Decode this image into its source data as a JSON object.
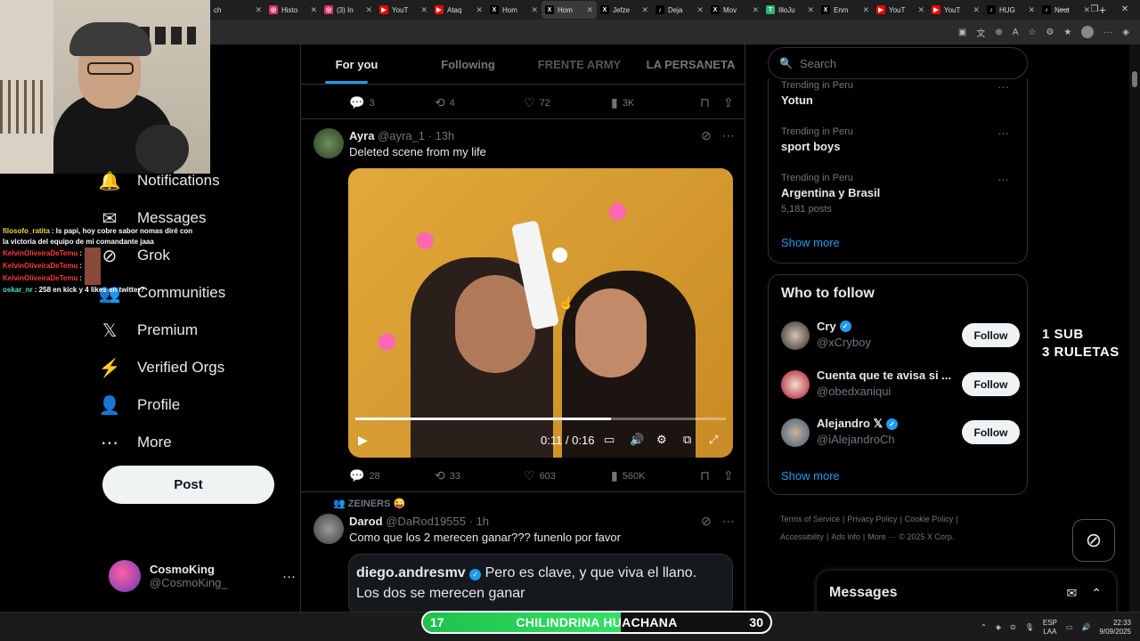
{
  "browser": {
    "tabs": [
      {
        "title": "Histo",
        "fav_color": "#e1306c",
        "fav": "◎"
      },
      {
        "title": "(3) In",
        "fav_color": "#e1306c",
        "fav": "◎"
      },
      {
        "title": "YouT",
        "fav_color": "#ff0000",
        "fav": "▶"
      },
      {
        "title": "Ataq",
        "fav_color": "#ff0000",
        "fav": "▶"
      },
      {
        "title": "Hom",
        "fav_color": "#000000",
        "fav": "X"
      },
      {
        "title": "Hom",
        "fav_color": "#000000",
        "fav": "X"
      },
      {
        "title": "Jefze",
        "fav_color": "#000000",
        "fav": "X"
      },
      {
        "title": "Deja",
        "fav_color": "#000000",
        "fav": "♪"
      },
      {
        "title": "Mov",
        "fav_color": "#000000",
        "fav": "X"
      },
      {
        "title": "IlloJu",
        "fav_color": "#2bb673",
        "fav": "T"
      },
      {
        "title": "Enm",
        "fav_color": "#000000",
        "fav": "X"
      },
      {
        "title": "YouT",
        "fav_color": "#ff0000",
        "fav": "▶"
      },
      {
        "title": "YouT",
        "fav_color": "#ff0000",
        "fav": "▶"
      },
      {
        "title": "HUG",
        "fav_color": "#000000",
        "fav": "♪"
      },
      {
        "title": "Neut",
        "fav_color": "#000000",
        "fav": "♪"
      }
    ],
    "active_tab_index": 5,
    "first_partial_tab": "ch"
  },
  "chat": [
    {
      "user": "filosofo_ratita",
      "user_color": "#f5d442",
      "text": " : Is papi, hoy cobre sabor nomas diré con"
    },
    {
      "user": "",
      "user_color": "#ffffff",
      "text": "la victoria del equipo de mi comandante jaaa"
    },
    {
      "user": "KelvinOliveiraDeTemu",
      "user_color": "#ff3b3b",
      "text": " :",
      "thumb": true
    },
    {
      "user": "KelvinOliveiraDeTemu",
      "user_color": "#ff3b3b",
      "text": " :",
      "thumb": true
    },
    {
      "user": "KelvinOliveiraDeTemu",
      "user_color": "#ff3b3b",
      "text": " :",
      "thumb": true
    },
    {
      "user": "oskar_nr",
      "user_color": "#4de3c9",
      "text": " : 258 en kick y 4 likes en twitter?"
    }
  ],
  "nav": [
    {
      "label": "Notifications",
      "icon": "🔔",
      "name": "bell-icon"
    },
    {
      "label": "Messages",
      "icon": "✉",
      "name": "envelope-icon"
    },
    {
      "label": "Grok",
      "icon": "⊘",
      "name": "grok-icon"
    },
    {
      "label": "Communities",
      "icon": "👥",
      "name": "communities-icon"
    },
    {
      "label": "Premium",
      "icon": "𝕏",
      "name": "x-logo-icon"
    },
    {
      "label": "Verified Orgs",
      "icon": "⚡",
      "name": "lightning-icon"
    },
    {
      "label": "Profile",
      "icon": "👤",
      "name": "person-icon"
    },
    {
      "label": "More",
      "icon": "⋯",
      "name": "more-circle-icon"
    }
  ],
  "post_button": "Post",
  "account": {
    "name": "CosmoKing",
    "handle": "@CosmoKing_",
    "dots": "···"
  },
  "feed_tabs": [
    "For you",
    "Following",
    "FRENTE ARMY",
    "LA PERSANETA"
  ],
  "tweet_prev_actions": {
    "replies": "3",
    "reposts": "4",
    "likes": "72",
    "views": "3K"
  },
  "tweet1": {
    "name": "Ayra",
    "handle": "@ayra_1",
    "time": "· 13h",
    "text": "Deleted scene from my life",
    "video_time": "0:11 / 0:16",
    "video_progress": 0.69,
    "actions": {
      "replies": "28",
      "reposts": "33",
      "likes": "603",
      "views": "560K"
    }
  },
  "tweet2": {
    "social_context": "ZEINERS 😜",
    "name": "Darod",
    "handle": "@DaRod19555",
    "time": "· 1h",
    "text": "Como que los 2 merecen ganar??? funenlo por favor",
    "quote_name": "diego.andresmv",
    "quote_text1": "Pero es clave, y que viva el llano.",
    "quote_text2": "Los dos se merecen ganar"
  },
  "search": {
    "placeholder": "Search"
  },
  "trends": [
    {
      "context": "Trending in Peru",
      "title": "Yotun",
      "count": ""
    },
    {
      "context": "Trending in Peru",
      "title": "sport boys",
      "count": ""
    },
    {
      "context": "Trending in Peru",
      "title": "Argentina y Brasil",
      "count": "5,181 posts"
    }
  ],
  "show_more": "Show more",
  "who_to_follow": {
    "title": "Who to follow",
    "follow_label": "Follow",
    "accounts": [
      {
        "name": "Cry",
        "handle": "@xCryboy",
        "verified": true
      },
      {
        "name": "Cuenta que te avisa si ...",
        "handle": "@obedxaniqui",
        "verified": false
      },
      {
        "name": "Alejandro 𝕏",
        "handle": "@iAlejandroCh",
        "verified": true
      }
    ]
  },
  "footer": {
    "l1": [
      "Terms of Service",
      "|",
      "Privacy Policy",
      "|",
      "Cookie Policy",
      "|"
    ],
    "l2": [
      "Accessibility",
      "|",
      "Ads info",
      "|",
      "More ···",
      "© 2025 X Corp."
    ]
  },
  "overlay": {
    "line1": "1 SUB",
    "line2": "3 RULETAS"
  },
  "messages_drawer": {
    "title": "Messages"
  },
  "stream_bar": {
    "left": "17",
    "center": "CHILINDRINA HUACHANA",
    "right": "30",
    "progress": 0.57
  },
  "tray": {
    "lang1": "ESP",
    "lang2": "LAA",
    "time": "22:33",
    "date": "9/09/2025"
  }
}
